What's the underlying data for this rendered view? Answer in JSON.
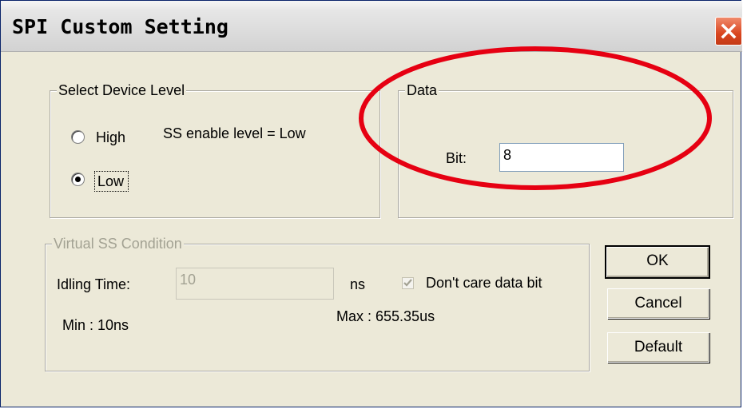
{
  "window": {
    "title": "SPI Custom Setting"
  },
  "device_level": {
    "legend": "Select Device Level",
    "options": [
      {
        "label": "High",
        "selected": false
      },
      {
        "label": "Low",
        "selected": true
      }
    ],
    "status_text": "SS enable level  = Low"
  },
  "data_group": {
    "legend": "Data",
    "bit_label": "Bit:",
    "bit_value": "8"
  },
  "virtual_ss": {
    "legend": "Virtual  SS Condition",
    "idling_label": "Idling Time:",
    "idling_value": "10",
    "unit": "ns",
    "dont_care_label": "Don't care data bit",
    "dont_care_checked": true,
    "min_text": "Min : 10ns",
    "max_text": "Max : 655.35us"
  },
  "buttons": {
    "ok": "OK",
    "cancel": "Cancel",
    "default": "Default"
  },
  "annotation_color": "#e60012"
}
